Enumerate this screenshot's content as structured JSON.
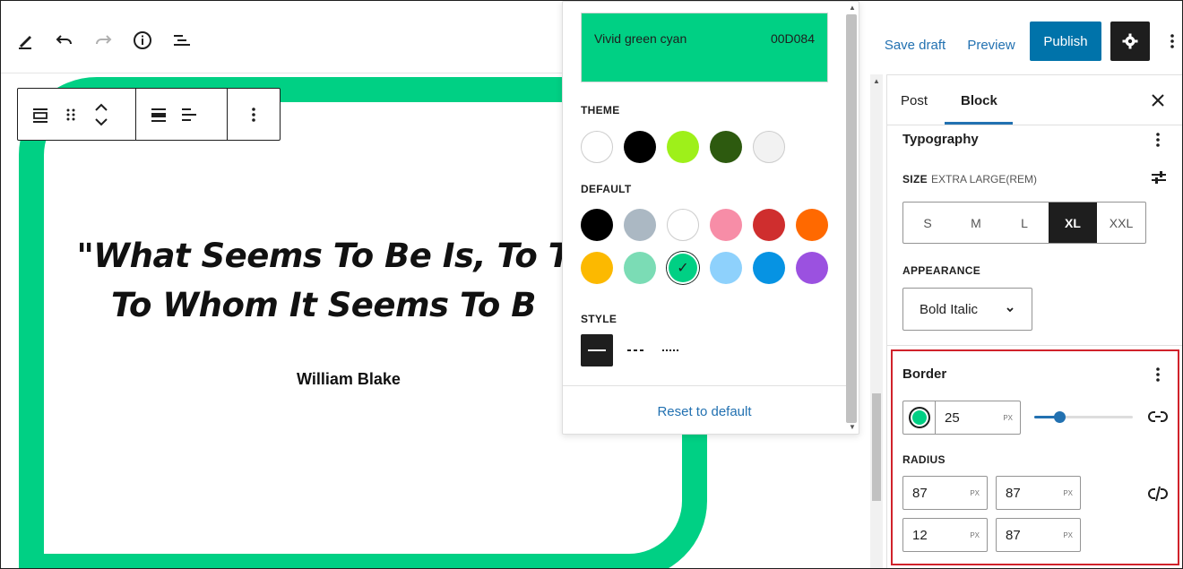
{
  "toolbar": {
    "icons": [
      "pencil-icon",
      "undo-icon",
      "redo-icon",
      "info-icon",
      "list-view-icon"
    ]
  },
  "block_toolbar": {
    "icons": [
      "block-type-icon",
      "drag-handle-icon",
      "move-up-down-icon",
      "align-icon",
      "text-align-icon",
      "more-options-icon"
    ]
  },
  "canvas": {
    "quote_line1": "\"What Seems To Be Is, To T",
    "quote_line2": "To Whom It Seems To B",
    "citation": "William Blake",
    "border_color": "#00D084"
  },
  "color_popover": {
    "selected_name": "Vivid green cyan",
    "selected_hex": "00D084",
    "theme_label": "THEME",
    "theme_colors": [
      "#ffffff",
      "#000000",
      "#9ef01a",
      "#2d5a0f",
      "#f2f2f2"
    ],
    "default_label": "DEFAULT",
    "default_colors": [
      "#000000",
      "#abb8c3",
      "#ffffff",
      "#f78da7",
      "#cf2e2e",
      "#ff6900",
      "#fcb900",
      "#7bdcb5",
      "#00d084",
      "#8ed1fc",
      "#0693e3",
      "#9b51e0"
    ],
    "selected_default_index": 8,
    "check_mark": "✓",
    "style_label": "STYLE",
    "reset_label": "Reset to default"
  },
  "header": {
    "save_draft": "Save draft",
    "preview": "Preview",
    "publish": "Publish",
    "accent": "#0073aa"
  },
  "sidebar": {
    "tab_post": "Post",
    "tab_block": "Block",
    "typography_title": "Typography",
    "size_label": "SIZE",
    "size_value": "EXTRA LARGE(REM)",
    "sizes": [
      "S",
      "M",
      "L",
      "XL",
      "XXL"
    ],
    "active_size": "XL",
    "appearance_label": "APPEARANCE",
    "appearance_value": "Bold Italic",
    "border_title": "Border",
    "border_width": "25",
    "unit": "PX",
    "border_slider_fraction": 0.25,
    "radius_label": "RADIUS",
    "radius_values": [
      "87",
      "87",
      "12",
      "87"
    ]
  }
}
